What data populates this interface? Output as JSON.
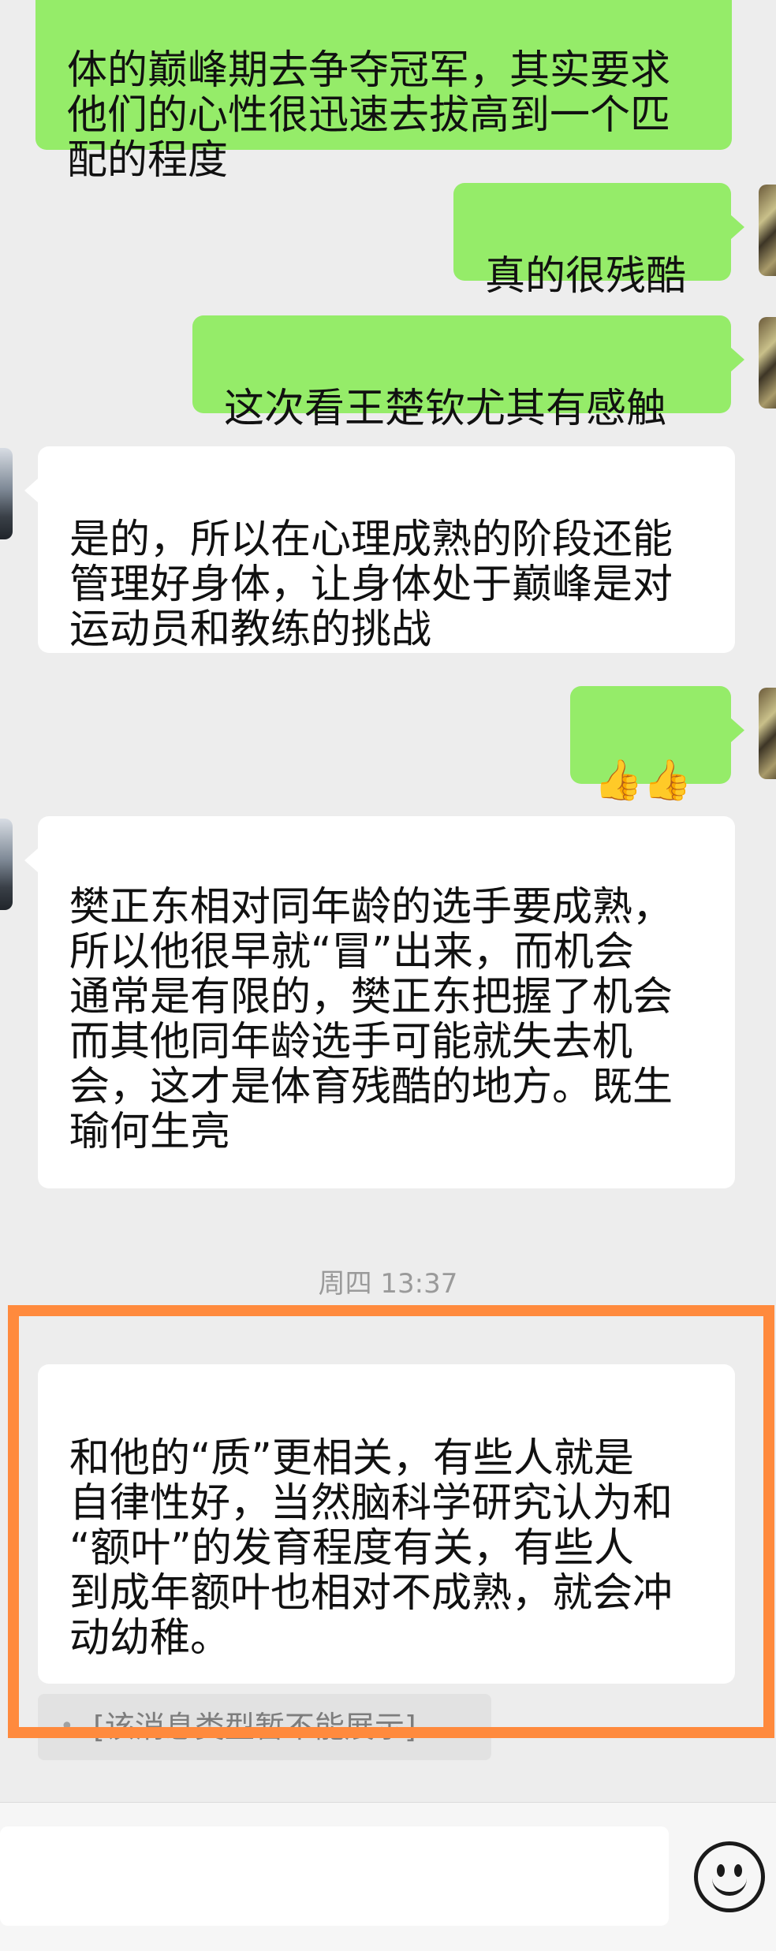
{
  "messages": [
    {
      "side": "out",
      "text": "体的巅峰期去争夺冠军，其实要求\n他们的心性很迅速去拔高到一个匹\n配的程度"
    },
    {
      "side": "out",
      "text": "真的很残酷"
    },
    {
      "side": "out",
      "text": "这次看王楚钦尤其有感触"
    },
    {
      "side": "in",
      "text": "是的，所以在心理成熟的阶段还能\n管理好身体，让身体处于巅峰是对\n运动员和教练的挑战"
    },
    {
      "side": "out",
      "text": "👍👍"
    },
    {
      "side": "in",
      "text": "樊正东相对同年龄的选手要成熟，\n所以他很早就“冒”出来，而机会\n通常是有限的，樊正东把握了机会\n而其他同年龄选手可能就失去机\n会，这才是体育残酷的地方。既生\n瑜何生亮"
    },
    {
      "side": "in",
      "text": "和他的“质”更相关，有些人就是\n自律性好，当然脑科学研究认为和\n“额叶”的发育程度有关，有些人\n到成年额叶也相对不成熟，就会冲\n动幼稚。"
    }
  ],
  "timestamp": "周四 13:37",
  "quote": {
    "text": "[该消息类型暂不能展示]",
    "mark": "•"
  },
  "input": {
    "value": "",
    "placeholder": ""
  },
  "icons": {
    "emoji": "emoji-face-icon"
  },
  "colors": {
    "outgoing_bubble": "#95ec69",
    "incoming_bubble": "#ffffff",
    "highlight_border": "#ff8a3d",
    "background": "#ededed"
  }
}
